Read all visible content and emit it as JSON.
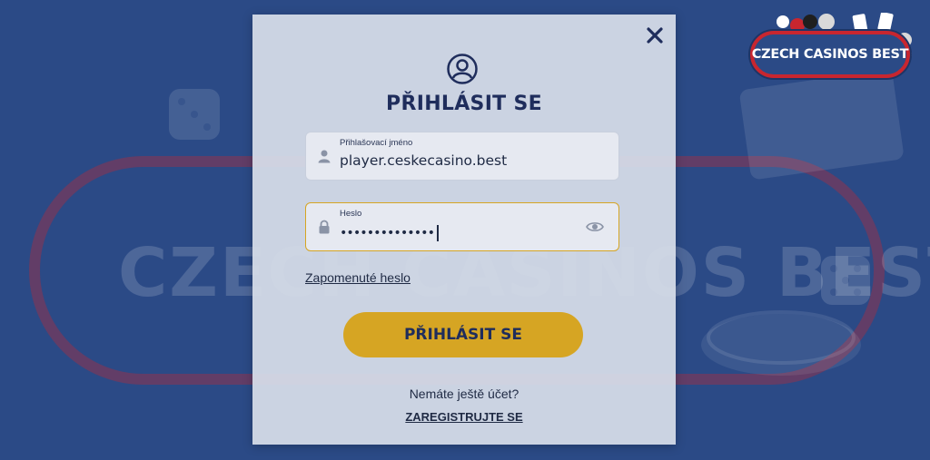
{
  "background": {
    "watermark_text": "CZECH CASINOS BEST",
    "brand_logo_text": "CZECH CASINOS BEST",
    "colors": {
      "page_bg": "#2b4a86",
      "brand_red": "#c8262f"
    }
  },
  "modal": {
    "title": "PŘIHLÁSIT SE",
    "close_icon": "close-icon",
    "user_icon": "user-circle-icon",
    "username_field": {
      "label": "Přihlašovací jméno",
      "value": "player.ceskecasino.best",
      "icon": "person-icon"
    },
    "password_field": {
      "label": "Heslo",
      "masked_value": "••••••••••••••",
      "icon": "lock-icon",
      "toggle_icon": "eye-icon"
    },
    "forgot_password": "Zapomenuté heslo",
    "submit_label": "PŘIHLÁSIT SE",
    "no_account_text": "Nemáte ještě účet?",
    "register_label": "ZAREGISTRUJTE SE",
    "colors": {
      "accent": "#d6a523",
      "title": "#1f2d5c"
    }
  }
}
